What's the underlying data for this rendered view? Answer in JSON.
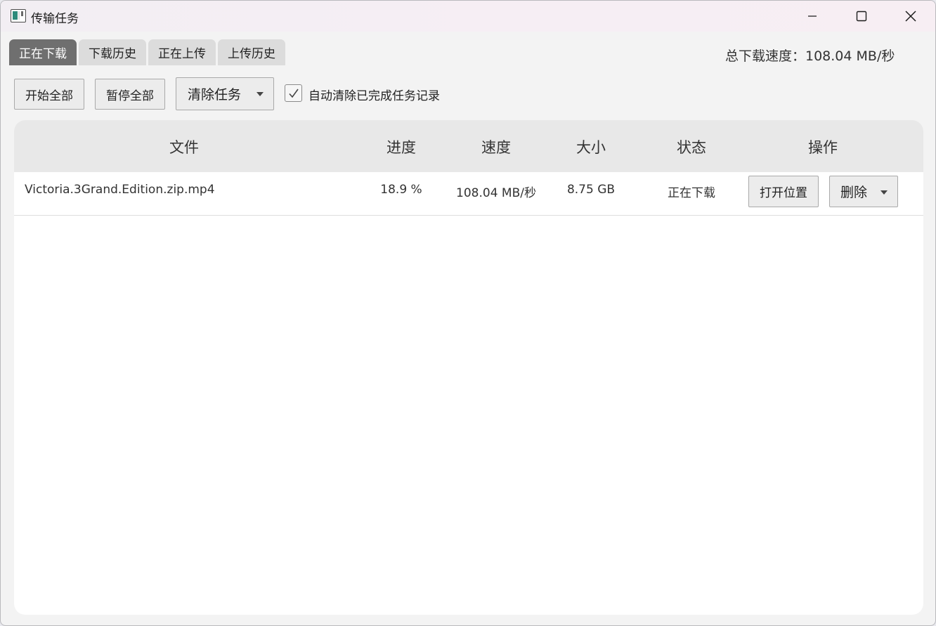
{
  "window": {
    "title": "传输任务"
  },
  "tabs": [
    {
      "label": "正在下载",
      "active": true
    },
    {
      "label": "下载历史",
      "active": false
    },
    {
      "label": "正在上传",
      "active": false
    },
    {
      "label": "上传历史",
      "active": false
    }
  ],
  "speed_summary": "总下载速度：108.04 MB/秒",
  "toolbar": {
    "start_all_label": "开始全部",
    "pause_all_label": "暂停全部",
    "clear_tasks_label": "清除任务",
    "auto_clear_label": "自动清除已完成任务记录",
    "auto_clear_checked": true
  },
  "table": {
    "columns": [
      "文件",
      "进度",
      "速度",
      "大小",
      "状态",
      "操作"
    ],
    "rows": [
      {
        "file": "Victoria.3Grand.Edition.zip.mp4",
        "progress": "18.9 %",
        "speed": "108.04 MB/秒",
        "size": "8.75 GB",
        "status": "正在下载",
        "open_label": "打开位置",
        "delete_label": "删除"
      }
    ]
  },
  "icons": {
    "app": "transfer-app-icon",
    "minimize": "minimize-icon",
    "maximize": "maximize-icon",
    "close": "close-icon",
    "check": "checkmark-icon",
    "dropdown": "chevron-down-icon"
  },
  "colors": {
    "active_tab": "#6f6f6f",
    "inactive_tab": "#dcdcdc",
    "table_header": "#e8e8e8"
  }
}
